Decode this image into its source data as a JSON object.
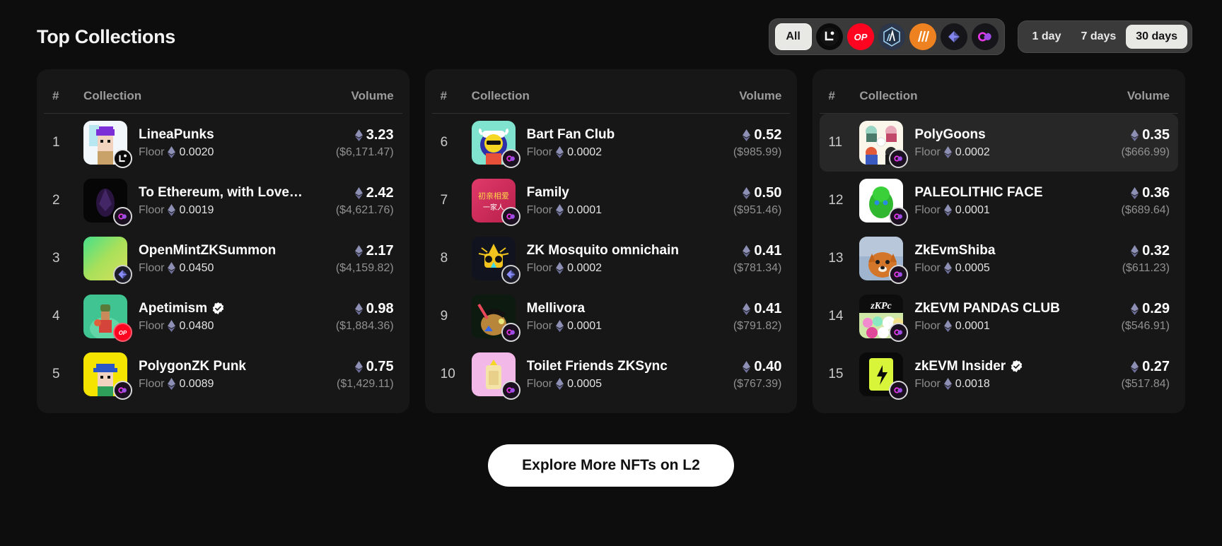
{
  "header": {
    "title": "Top Collections",
    "chain_filters": [
      {
        "id": "all",
        "label": "All",
        "selected": true
      },
      {
        "id": "linea",
        "label": "Linea",
        "selected": false
      },
      {
        "id": "op",
        "label": "OP",
        "selected": false
      },
      {
        "id": "arb",
        "label": "Arbitrum",
        "selected": false
      },
      {
        "id": "nova",
        "label": "Nova",
        "selected": false
      },
      {
        "id": "zksync",
        "label": "zkSync",
        "selected": false
      },
      {
        "id": "polygon",
        "label": "Polygon zkEVM",
        "selected": false
      }
    ],
    "time_filters": [
      {
        "label": "1 day",
        "selected": false
      },
      {
        "label": "7 days",
        "selected": false
      },
      {
        "label": "30 days",
        "selected": true
      }
    ]
  },
  "table": {
    "columns": {
      "rank": "#",
      "collection": "Collection",
      "volume": "Volume"
    },
    "floor_label": "Floor"
  },
  "colors": {
    "background": "#0d0d0d",
    "panel": "#171717",
    "row_highlight": "#272727",
    "accent_white": "#ffffff",
    "muted": "#8e8e8e",
    "eth_glyph": "#8d8fb5",
    "verified_blue": "#ffffff"
  },
  "rows": [
    {
      "rank": "1",
      "name": "LineaPunks",
      "floor": "0.0020",
      "volume_eth": "3.23",
      "volume_usd": "($6,171.47)",
      "chain": "linea",
      "verified": false,
      "highlight": false,
      "art": "lineapunks"
    },
    {
      "rank": "2",
      "name": "To Ethereum, with Love…",
      "floor": "0.0019",
      "volume_eth": "2.42",
      "volume_usd": "($4,621.76)",
      "chain": "polygon",
      "verified": false,
      "highlight": false,
      "art": "toeth"
    },
    {
      "rank": "3",
      "name": "OpenMintZKSummon",
      "floor": "0.0450",
      "volume_eth": "2.17",
      "volume_usd": "($4,159.82)",
      "chain": "zksync",
      "verified": false,
      "highlight": false,
      "art": "openmint"
    },
    {
      "rank": "4",
      "name": "Apetimism",
      "floor": "0.0480",
      "volume_eth": "0.98",
      "volume_usd": "($1,884.36)",
      "chain": "op",
      "verified": true,
      "highlight": false,
      "art": "apetimism"
    },
    {
      "rank": "5",
      "name": "PolygonZK Punk",
      "floor": "0.0089",
      "volume_eth": "0.75",
      "volume_usd": "($1,429.11)",
      "chain": "polygon",
      "verified": false,
      "highlight": false,
      "art": "polygonzkpunk"
    },
    {
      "rank": "6",
      "name": "Bart Fan Club",
      "floor": "0.0002",
      "volume_eth": "0.52",
      "volume_usd": "($985.99)",
      "chain": "polygon",
      "verified": false,
      "highlight": false,
      "art": "bart"
    },
    {
      "rank": "7",
      "name": "Family",
      "floor": "0.0001",
      "volume_eth": "0.50",
      "volume_usd": "($951.46)",
      "chain": "polygon",
      "verified": false,
      "highlight": false,
      "art": "family"
    },
    {
      "rank": "8",
      "name": "ZK Mosquito omnichain",
      "floor": "0.0002",
      "volume_eth": "0.41",
      "volume_usd": "($781.34)",
      "chain": "zksync",
      "verified": false,
      "highlight": false,
      "art": "mosquito"
    },
    {
      "rank": "9",
      "name": "Mellivora",
      "floor": "0.0001",
      "volume_eth": "0.41",
      "volume_usd": "($791.82)",
      "chain": "polygon",
      "verified": false,
      "highlight": false,
      "art": "mellivora"
    },
    {
      "rank": "10",
      "name": "Toilet Friends ZKSync",
      "floor": "0.0005",
      "volume_eth": "0.40",
      "volume_usd": "($767.39)",
      "chain": "polygon",
      "verified": false,
      "highlight": false,
      "art": "toilet"
    },
    {
      "rank": "11",
      "name": "PolyGoons",
      "floor": "0.0002",
      "volume_eth": "0.35",
      "volume_usd": "($666.99)",
      "chain": "polygon",
      "verified": false,
      "highlight": true,
      "art": "polygoons"
    },
    {
      "rank": "12",
      "name": "PALEOLITHIC FACE",
      "floor": "0.0001",
      "volume_eth": "0.36",
      "volume_usd": "($689.64)",
      "chain": "polygon",
      "verified": false,
      "highlight": false,
      "art": "paleolithic"
    },
    {
      "rank": "13",
      "name": "ZkEvmShiba",
      "floor": "0.0005",
      "volume_eth": "0.32",
      "volume_usd": "($611.23)",
      "chain": "polygon",
      "verified": false,
      "highlight": false,
      "art": "shiba"
    },
    {
      "rank": "14",
      "name": "ZkEVM PANDAS CLUB",
      "floor": "0.0001",
      "volume_eth": "0.29",
      "volume_usd": "($546.91)",
      "chain": "polygon",
      "verified": false,
      "highlight": false,
      "art": "pandas"
    },
    {
      "rank": "15",
      "name": "zkEVM Insider",
      "floor": "0.0018",
      "volume_eth": "0.27",
      "volume_usd": "($517.84)",
      "chain": "polygon",
      "verified": true,
      "highlight": false,
      "art": "insider"
    }
  ],
  "footer": {
    "explore_label": "Explore More NFTs on L2"
  }
}
